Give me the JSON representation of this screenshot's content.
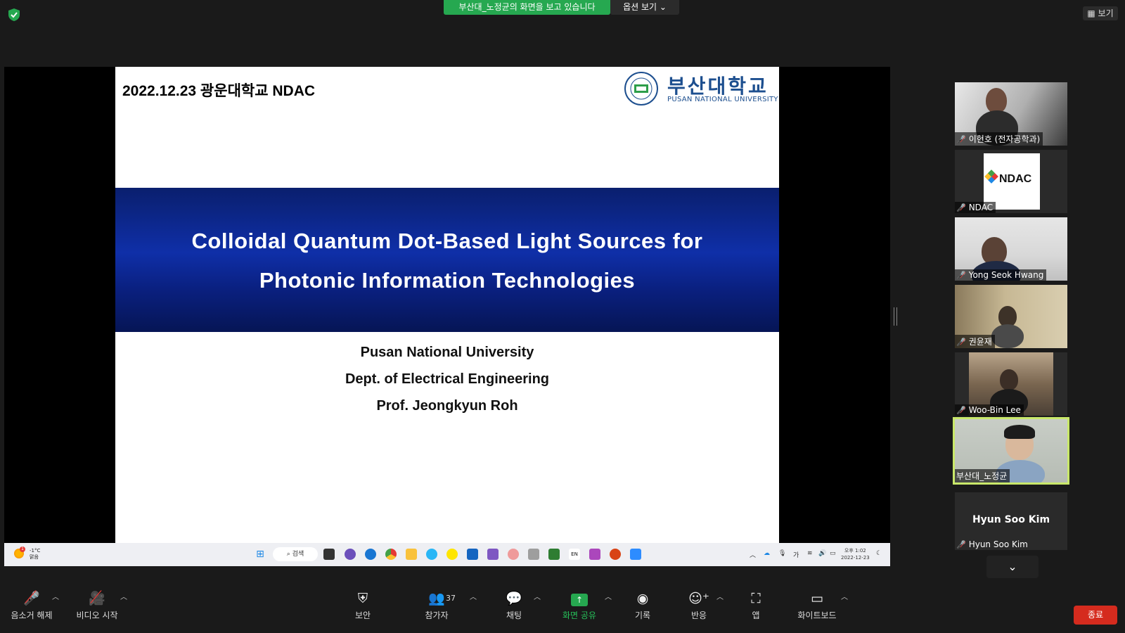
{
  "top": {
    "share_banner": "부산대_노정균의 화면을 보고 있습니다",
    "options_label": "옵션 보기 ⌄",
    "view_label": "보기"
  },
  "slide": {
    "date_line": "2022.12.23 광운대학교 NDAC",
    "logo_ko": "부산대학교",
    "logo_en": "PUSAN NATIONAL UNIVERSITY",
    "title_line1": "Colloidal Quantum Dot-Based Light Sources for",
    "title_line2": "Photonic Information Technologies",
    "university": "Pusan National University",
    "department": "Dept. of Electrical Engineering",
    "presenter": "Prof. Jeongkyun Roh"
  },
  "taskbar": {
    "temp": "-1°C",
    "weather": "맑음",
    "weather_badge": "1",
    "search_label": "검색",
    "lang": "가",
    "ime": "EN",
    "time": "오후 1:02",
    "date": "2022-12-23"
  },
  "participants": [
    {
      "name": "이현호 (전자공학과)"
    },
    {
      "name": "NDAC"
    },
    {
      "name": "Yong Seok Hwang"
    },
    {
      "name": "권윤재"
    },
    {
      "name": "Woo-Bin Lee"
    },
    {
      "name": "부산대_노정균"
    },
    {
      "name": "Hyun Soo Kim"
    }
  ],
  "ndac_logo_text": "NDAC",
  "toolbar": {
    "mute_label": "음소거 해제",
    "video_label": "비디오 시작",
    "security_label": "보안",
    "participants_label": "참가자",
    "participants_count": "37",
    "chat_label": "채팅",
    "share_label": "화면 공유",
    "record_label": "기록",
    "reactions_label": "반응",
    "apps_label": "앱",
    "whiteboard_label": "화이트보드",
    "end_label": "종료"
  },
  "colors": {
    "share_green": "#26a850",
    "end_red": "#d52b1e",
    "active_speaker": "#c9e86a",
    "slide_band": "#0f2fa8"
  }
}
